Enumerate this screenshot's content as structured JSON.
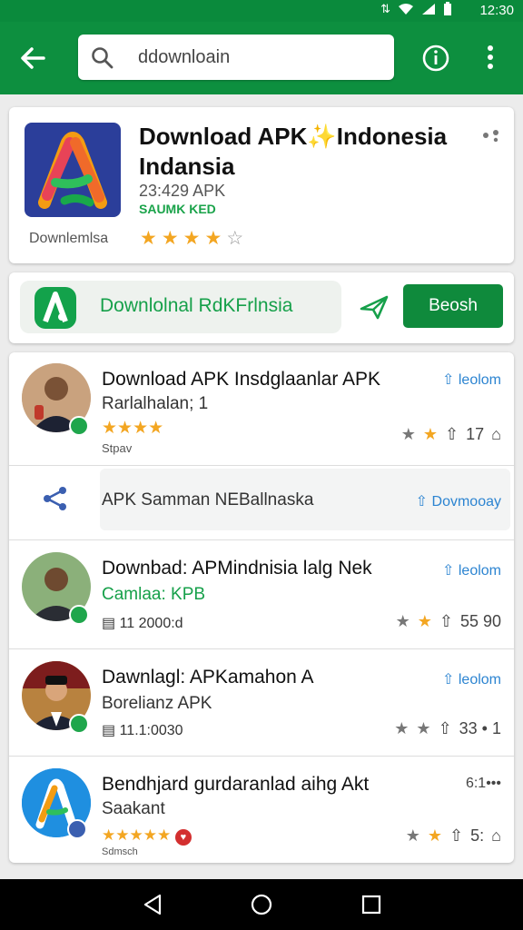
{
  "status": {
    "time": "12:30"
  },
  "search": {
    "value": "ddownloain"
  },
  "hero": {
    "title": "Download APK✨Indonesia Indansia",
    "size": "23:429 APK",
    "verified": "SAUMK KED",
    "brand": "Downlemlsa",
    "stars": [
      "★",
      "★",
      "★",
      "★",
      "☆"
    ]
  },
  "bar2": {
    "pill_text": "Downlolnal RdKFrlnsia",
    "button": "Beosh"
  },
  "items": [
    {
      "title": "Download APK Insdglaanlar APK",
      "sub": "Rarlalhalan; 1",
      "stars": "★★★★",
      "small": "Stpav",
      "tag": "leolom",
      "count": "17"
    },
    {
      "share_text": "APK Samman NEBallnaska",
      "tag": "Dovmooay"
    },
    {
      "title": "Downbad: APMindnisia lalg Nek",
      "sub": "Camlaa: KPB",
      "small": "11 2000:d",
      "tag": "leolom",
      "count": "55 90"
    },
    {
      "title": "Dawnlagl: APKamahon A",
      "sub": "Borelianz APK",
      "small": "11.1:0030",
      "tag": "leolom",
      "count": "33 • 1"
    },
    {
      "title": "Bendhjard gurdaranlad aihg Akt",
      "sub": "Saakant",
      "stars": "★★★★★",
      "small": "Sdmsch",
      "tag": "6:1•••",
      "count": "5:"
    }
  ]
}
